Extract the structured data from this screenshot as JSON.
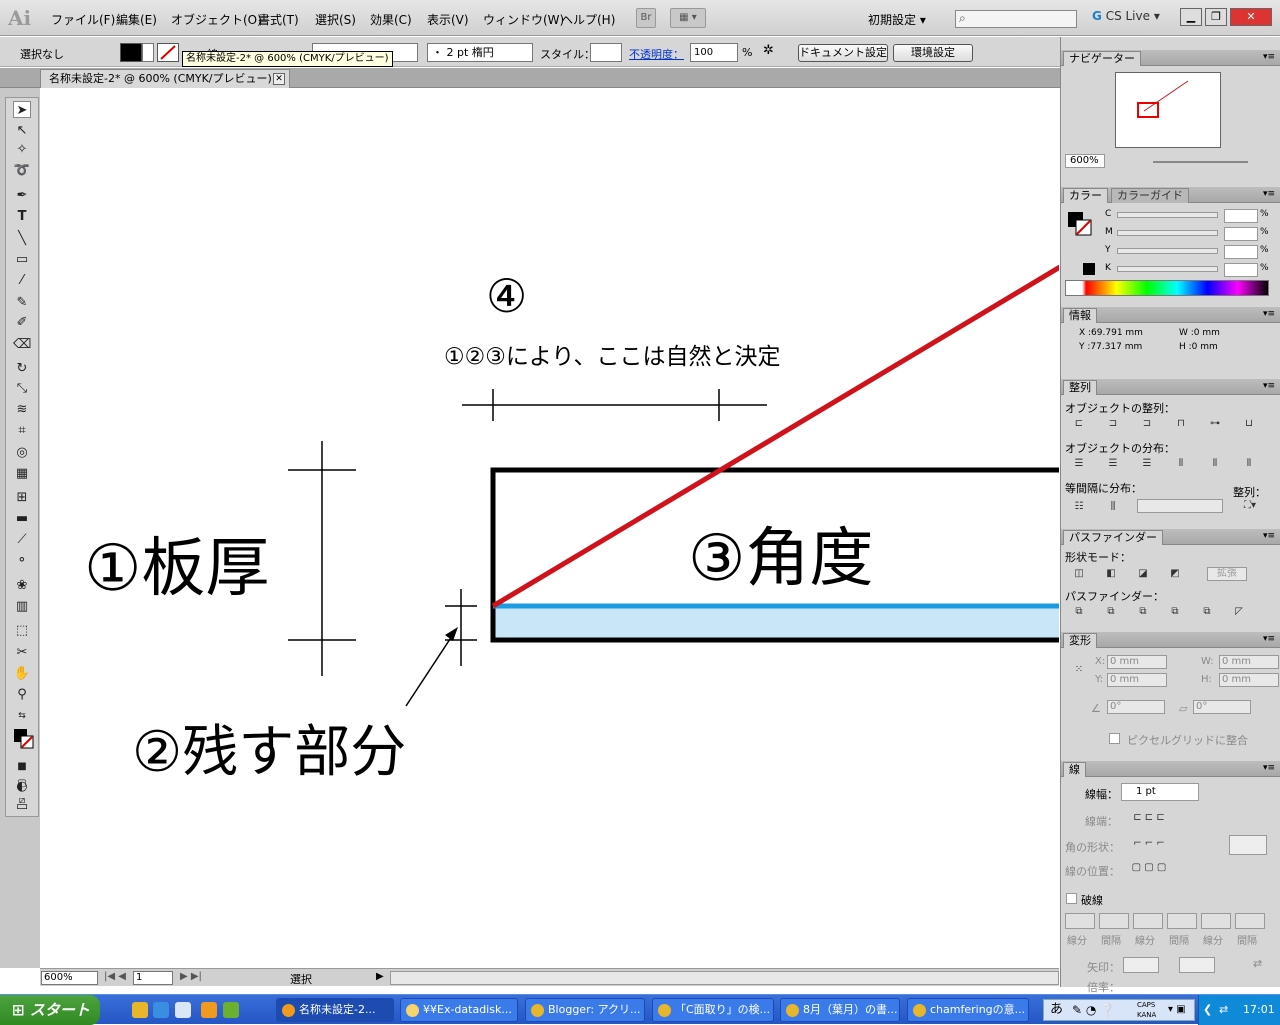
{
  "app": {
    "logo": "Ai"
  },
  "menu": [
    {
      "label": "ファイル(F)"
    },
    {
      "label": "編集(E)"
    },
    {
      "label": "オブジェクト(O)"
    },
    {
      "label": "書式(T)"
    },
    {
      "label": "選択(S)"
    },
    {
      "label": "効果(C)"
    },
    {
      "label": "表示(V)"
    },
    {
      "label": "ウィンドウ(W)"
    },
    {
      "label": "ヘルプ(H)"
    }
  ],
  "menubar": {
    "bridge": "Br",
    "workspace": "初期設定",
    "cslive": "CS Live"
  },
  "control": {
    "selection": "選択なし",
    "stroke_label": "線",
    "brush": "・ 2 pt 楕円",
    "style_label": "スタイル：",
    "opacity_label": "不透明度：",
    "opacity_value": "100",
    "opacity_unit": "%",
    "doc_settings": "ドキュメント設定",
    "prefs": "環境設定",
    "tooltip": "名称未設定-2* @ 600% (CMYK/プレビュー)"
  },
  "document": {
    "tab_title": "名称未設定-2* @ 600% (CMYK/プレビュー)"
  },
  "artwork": {
    "circle4": "④",
    "note": "①②③により、ここは自然と決定",
    "label1": "①板厚",
    "label2": "②残す部分",
    "label3": "③角度"
  },
  "status": {
    "zoom": "600%",
    "page": "1",
    "mode": "選択"
  },
  "navigator": {
    "tab": "ナビゲーター",
    "zoom": "600%"
  },
  "color_panel": {
    "tab1": "カラー",
    "tab2": "カラーガイド",
    "labels": [
      "C",
      "M",
      "Y",
      "K"
    ],
    "unit": "%"
  },
  "info": {
    "tab": "情報",
    "x": "X :69.791 mm",
    "y": "Y :77.317 mm",
    "w": "W :0 mm",
    "h": "H :0 mm"
  },
  "align": {
    "tab": "整列",
    "obj_align": "オブジェクトの整列：",
    "obj_dist": "オブジェクトの分布：",
    "spacing": "等間隔に分布：",
    "align_to": "整列："
  },
  "pathfinder": {
    "tab": "パスファインダー",
    "shape_modes": "形状モード：",
    "expand": "拡張",
    "pathfinders": "パスファインダー："
  },
  "transform": {
    "tab": "変形",
    "x_label": "X:",
    "y_label": "Y:",
    "w_label": "W:",
    "h_label": "H:",
    "x": "0 mm",
    "y": "0 mm",
    "w": "0 mm",
    "h": "0 mm",
    "angle": "0°",
    "shear": "0°",
    "pixel_grid": "ピクセルグリッドに整合"
  },
  "stroke": {
    "tab": "線",
    "weight_label": "線幅：",
    "weight": "1 pt",
    "cap": "線端：",
    "corner": "角の形状：",
    "align": "線の位置：",
    "dashed": "破線",
    "dash_labels": [
      "線分",
      "間隔",
      "線分",
      "間隔",
      "線分",
      "間隔"
    ],
    "arrow": "矢印：",
    "scale": "倍率："
  },
  "taskbar": {
    "start": "スタート",
    "tasks": [
      {
        "label": "名称未設定-2..."
      },
      {
        "label": "¥¥Ex-datadisk..."
      },
      {
        "label": "Blogger: アクリ..."
      },
      {
        "label": "「C面取り」の検..."
      },
      {
        "label": "8月（葉月）の書..."
      },
      {
        "label": "chamferingの意..."
      }
    ],
    "ime": "あ",
    "caps": "CAPS",
    "kana": "KANA",
    "clock": "17:01"
  },
  "colors": {
    "red_line": "#d0121b",
    "blue_line": "#1a9be2",
    "light_blue": "#c8e6f8"
  }
}
